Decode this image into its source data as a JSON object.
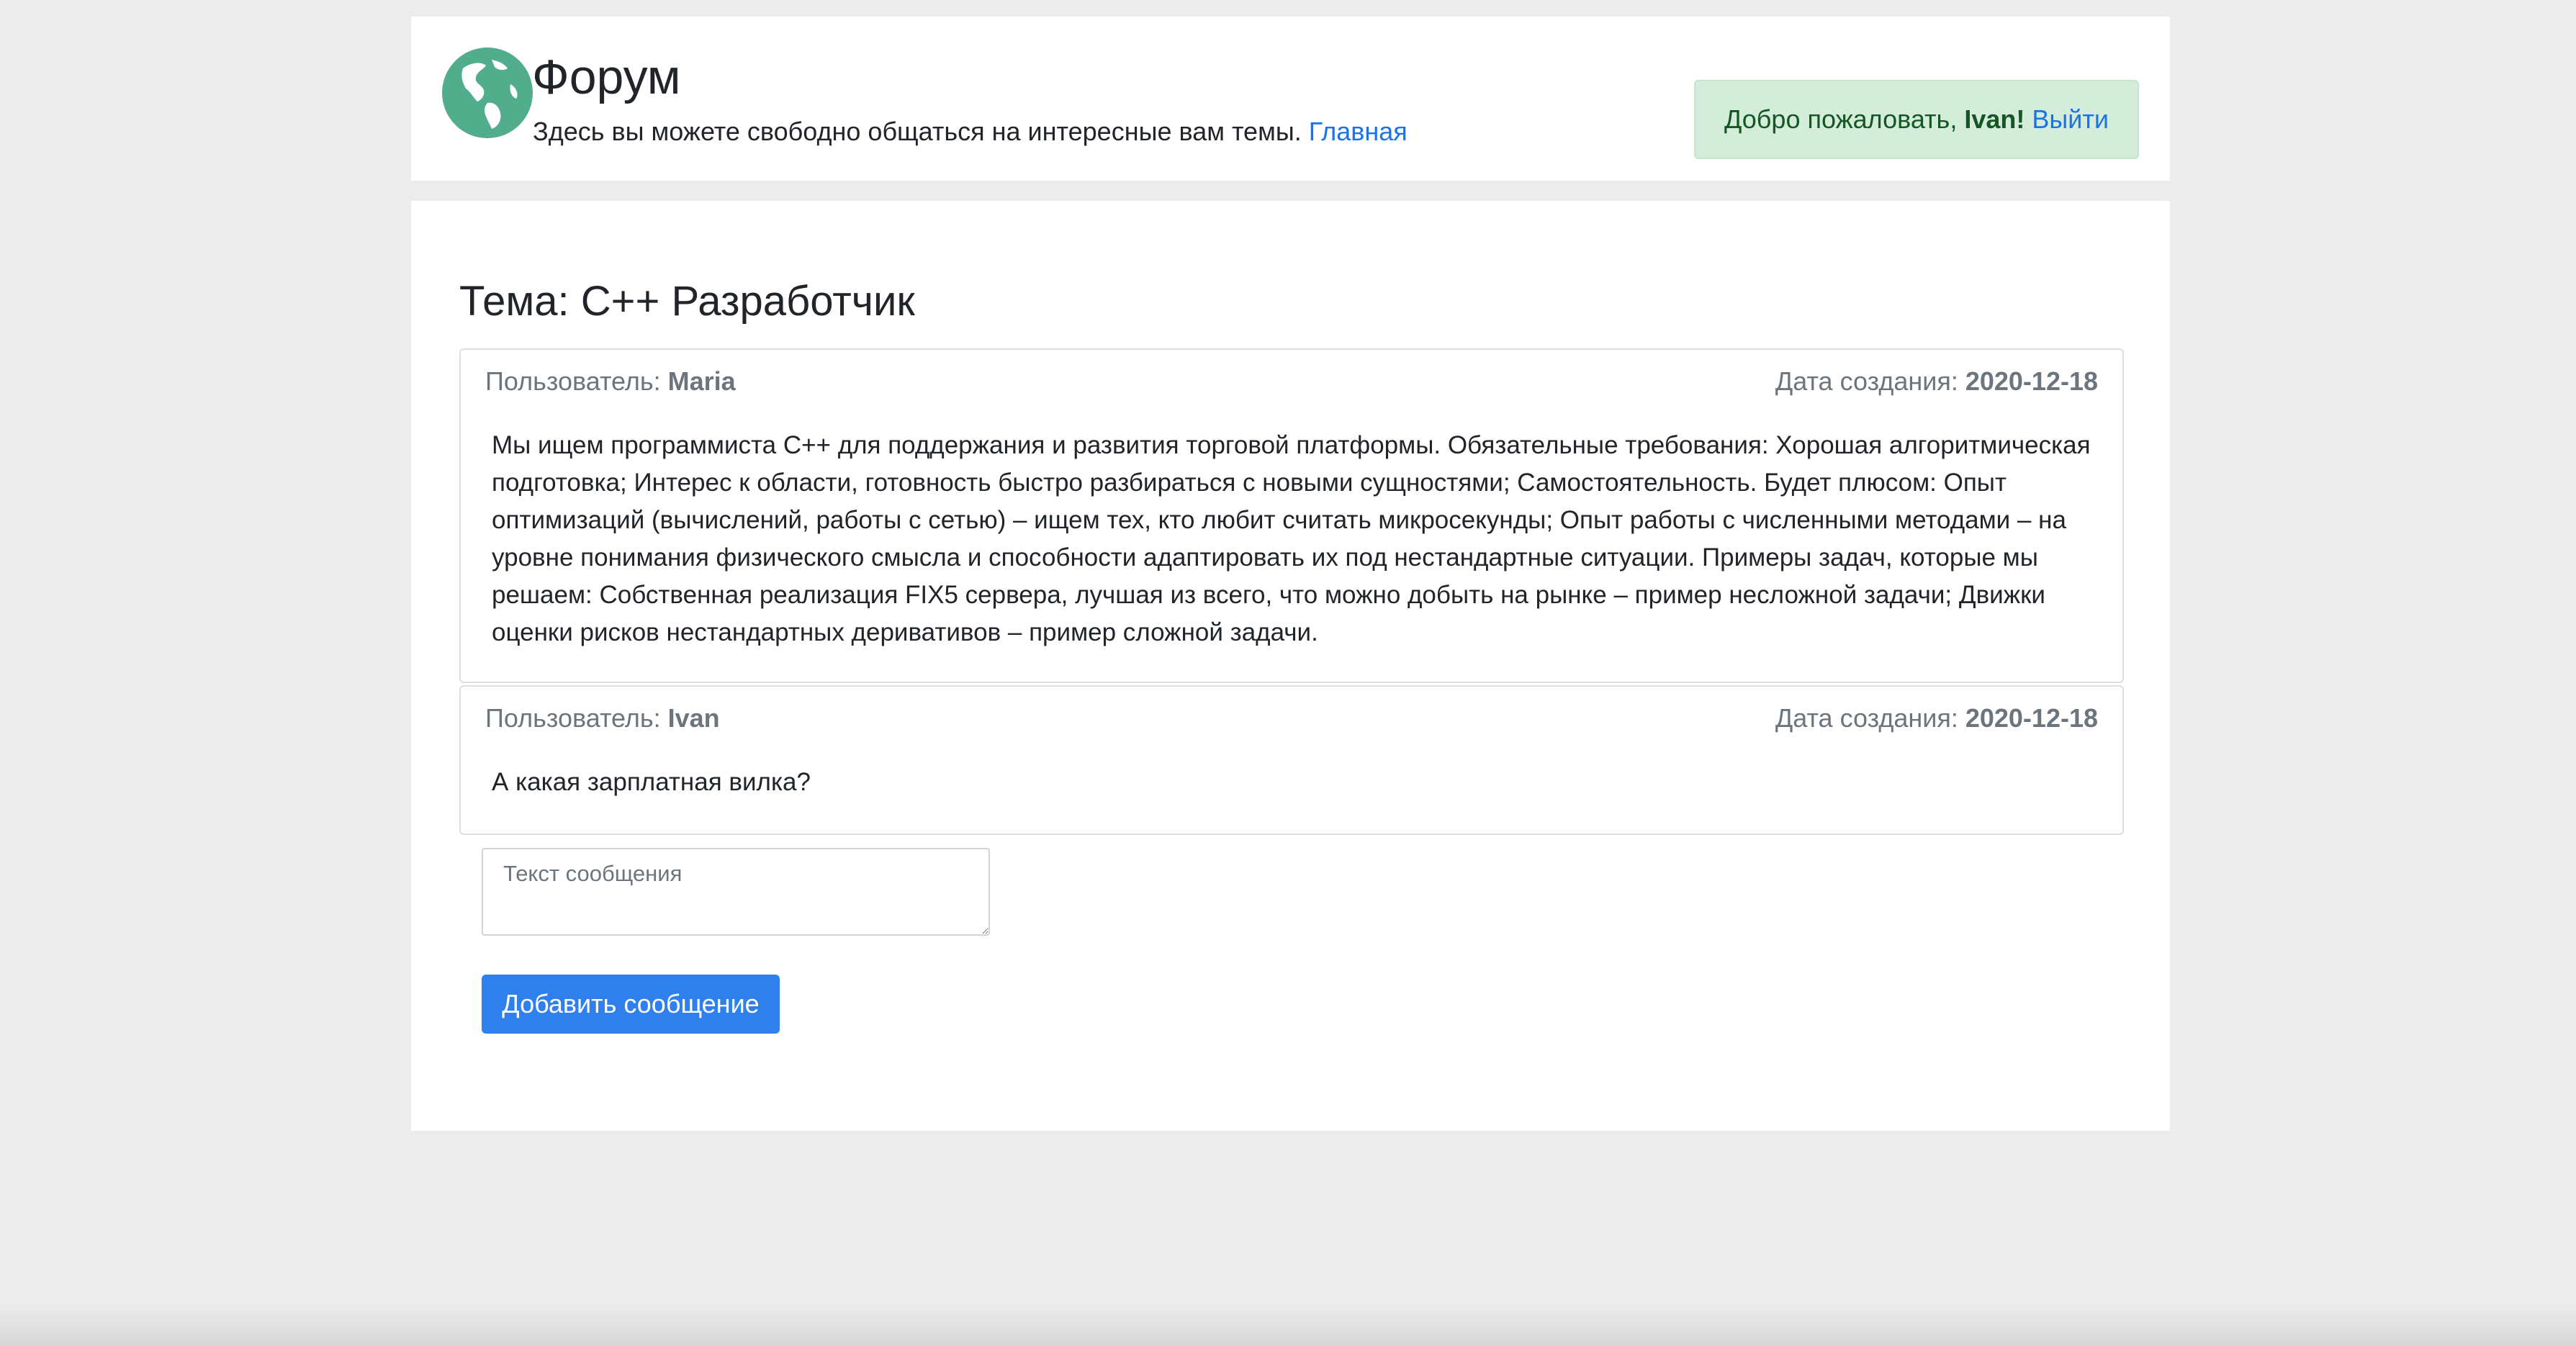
{
  "header": {
    "logo_icon": "globe-icon",
    "title": "Форум",
    "subtitle": "Здесь вы можете свободно общаться на интересные вам темы.",
    "home_link": "Главная",
    "welcome": {
      "greeting": "Добро пожаловать,",
      "username": "Ivan!",
      "logout_link": "Выйти"
    }
  },
  "topic": {
    "title": "Тема: C++ Разработчик"
  },
  "labels": {
    "user": "Пользователь:",
    "date": "Дата создания:"
  },
  "posts": [
    {
      "author": "Maria",
      "date": "2020-12-18",
      "text": "Мы ищем программиста С++ для поддержания и развития торговой платформы. Обязательные требования: Хорошая алгоритмическая подготовка; Интерес к области, готовность быстро разбираться с новыми сущностями; Самостоятельность. Будет плюсом: Опыт оптимизаций (вычислений, работы с сетью) – ищем тех, кто любит считать микросекунды; Опыт работы с численными методами – на уровне понимания физического смысла и способности адаптировать их под нестандартные ситуации. Примеры задач, которые мы решаем: Собственная реализация FIX5 сервера, лучшая из всего, что можно добыть на рынке – пример несложной задачи; Движки оценки рисков нестандартных деривативов – пример сложной задачи."
    },
    {
      "author": "Ivan",
      "date": "2020-12-18",
      "text": "А какая зарплатная вилка?"
    }
  ],
  "reply_form": {
    "placeholder": "Текст сообщения",
    "value": "",
    "submit_label": "Добавить сообщение"
  },
  "colors": {
    "page_background": "#ececec",
    "card_background": "#ffffff",
    "link": "#1a73e8",
    "welcome_background": "#d4edda",
    "welcome_text": "#155724",
    "button": "#2f80ed",
    "logo": "#4caf8f"
  }
}
